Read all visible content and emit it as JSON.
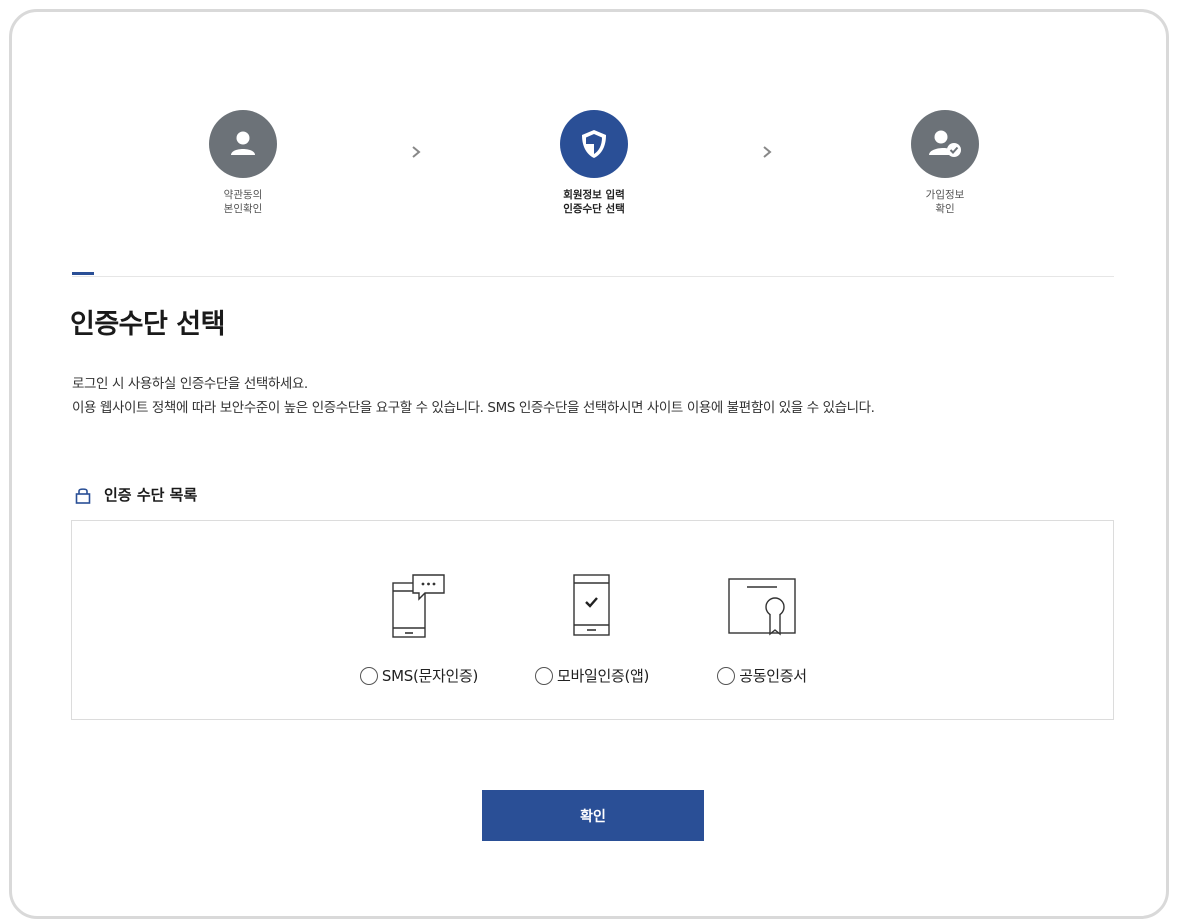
{
  "steps": [
    {
      "line1": "약관동의",
      "line2": "본인확인",
      "icon": "user-icon",
      "state": "done"
    },
    {
      "line1": "회원정보 입력",
      "line2": "인증수단 선택",
      "icon": "shield-icon",
      "state": "active"
    },
    {
      "line1": "가입정보",
      "line2": "확인",
      "icon": "user-check-icon",
      "state": "pending"
    }
  ],
  "page": {
    "title": "인증수단 선택",
    "desc_line1": "로그인 시 사용하실 인증수단을 선택하세요.",
    "desc_line2": "이용 웹사이트 정책에 따라 보안수준이 높은 인증수단을 요구할 수 있습니다. SMS 인증수단을 선택하시면 사이트 이용에 불편함이 있을 수 있습니다."
  },
  "auth_list": {
    "title": "인증 수단 목록",
    "options": [
      {
        "label": "SMS(문자인증)",
        "icon": "sms-phone-icon",
        "selected": false
      },
      {
        "label": "모바일인증(앱)",
        "icon": "mobile-check-icon",
        "selected": false
      },
      {
        "label": "공동인증서",
        "icon": "certificate-icon",
        "selected": false
      }
    ]
  },
  "confirm_label": "확인",
  "colors": {
    "accent": "#2a4f96",
    "step_gray": "#6c7278",
    "border": "#dcdcdc"
  }
}
